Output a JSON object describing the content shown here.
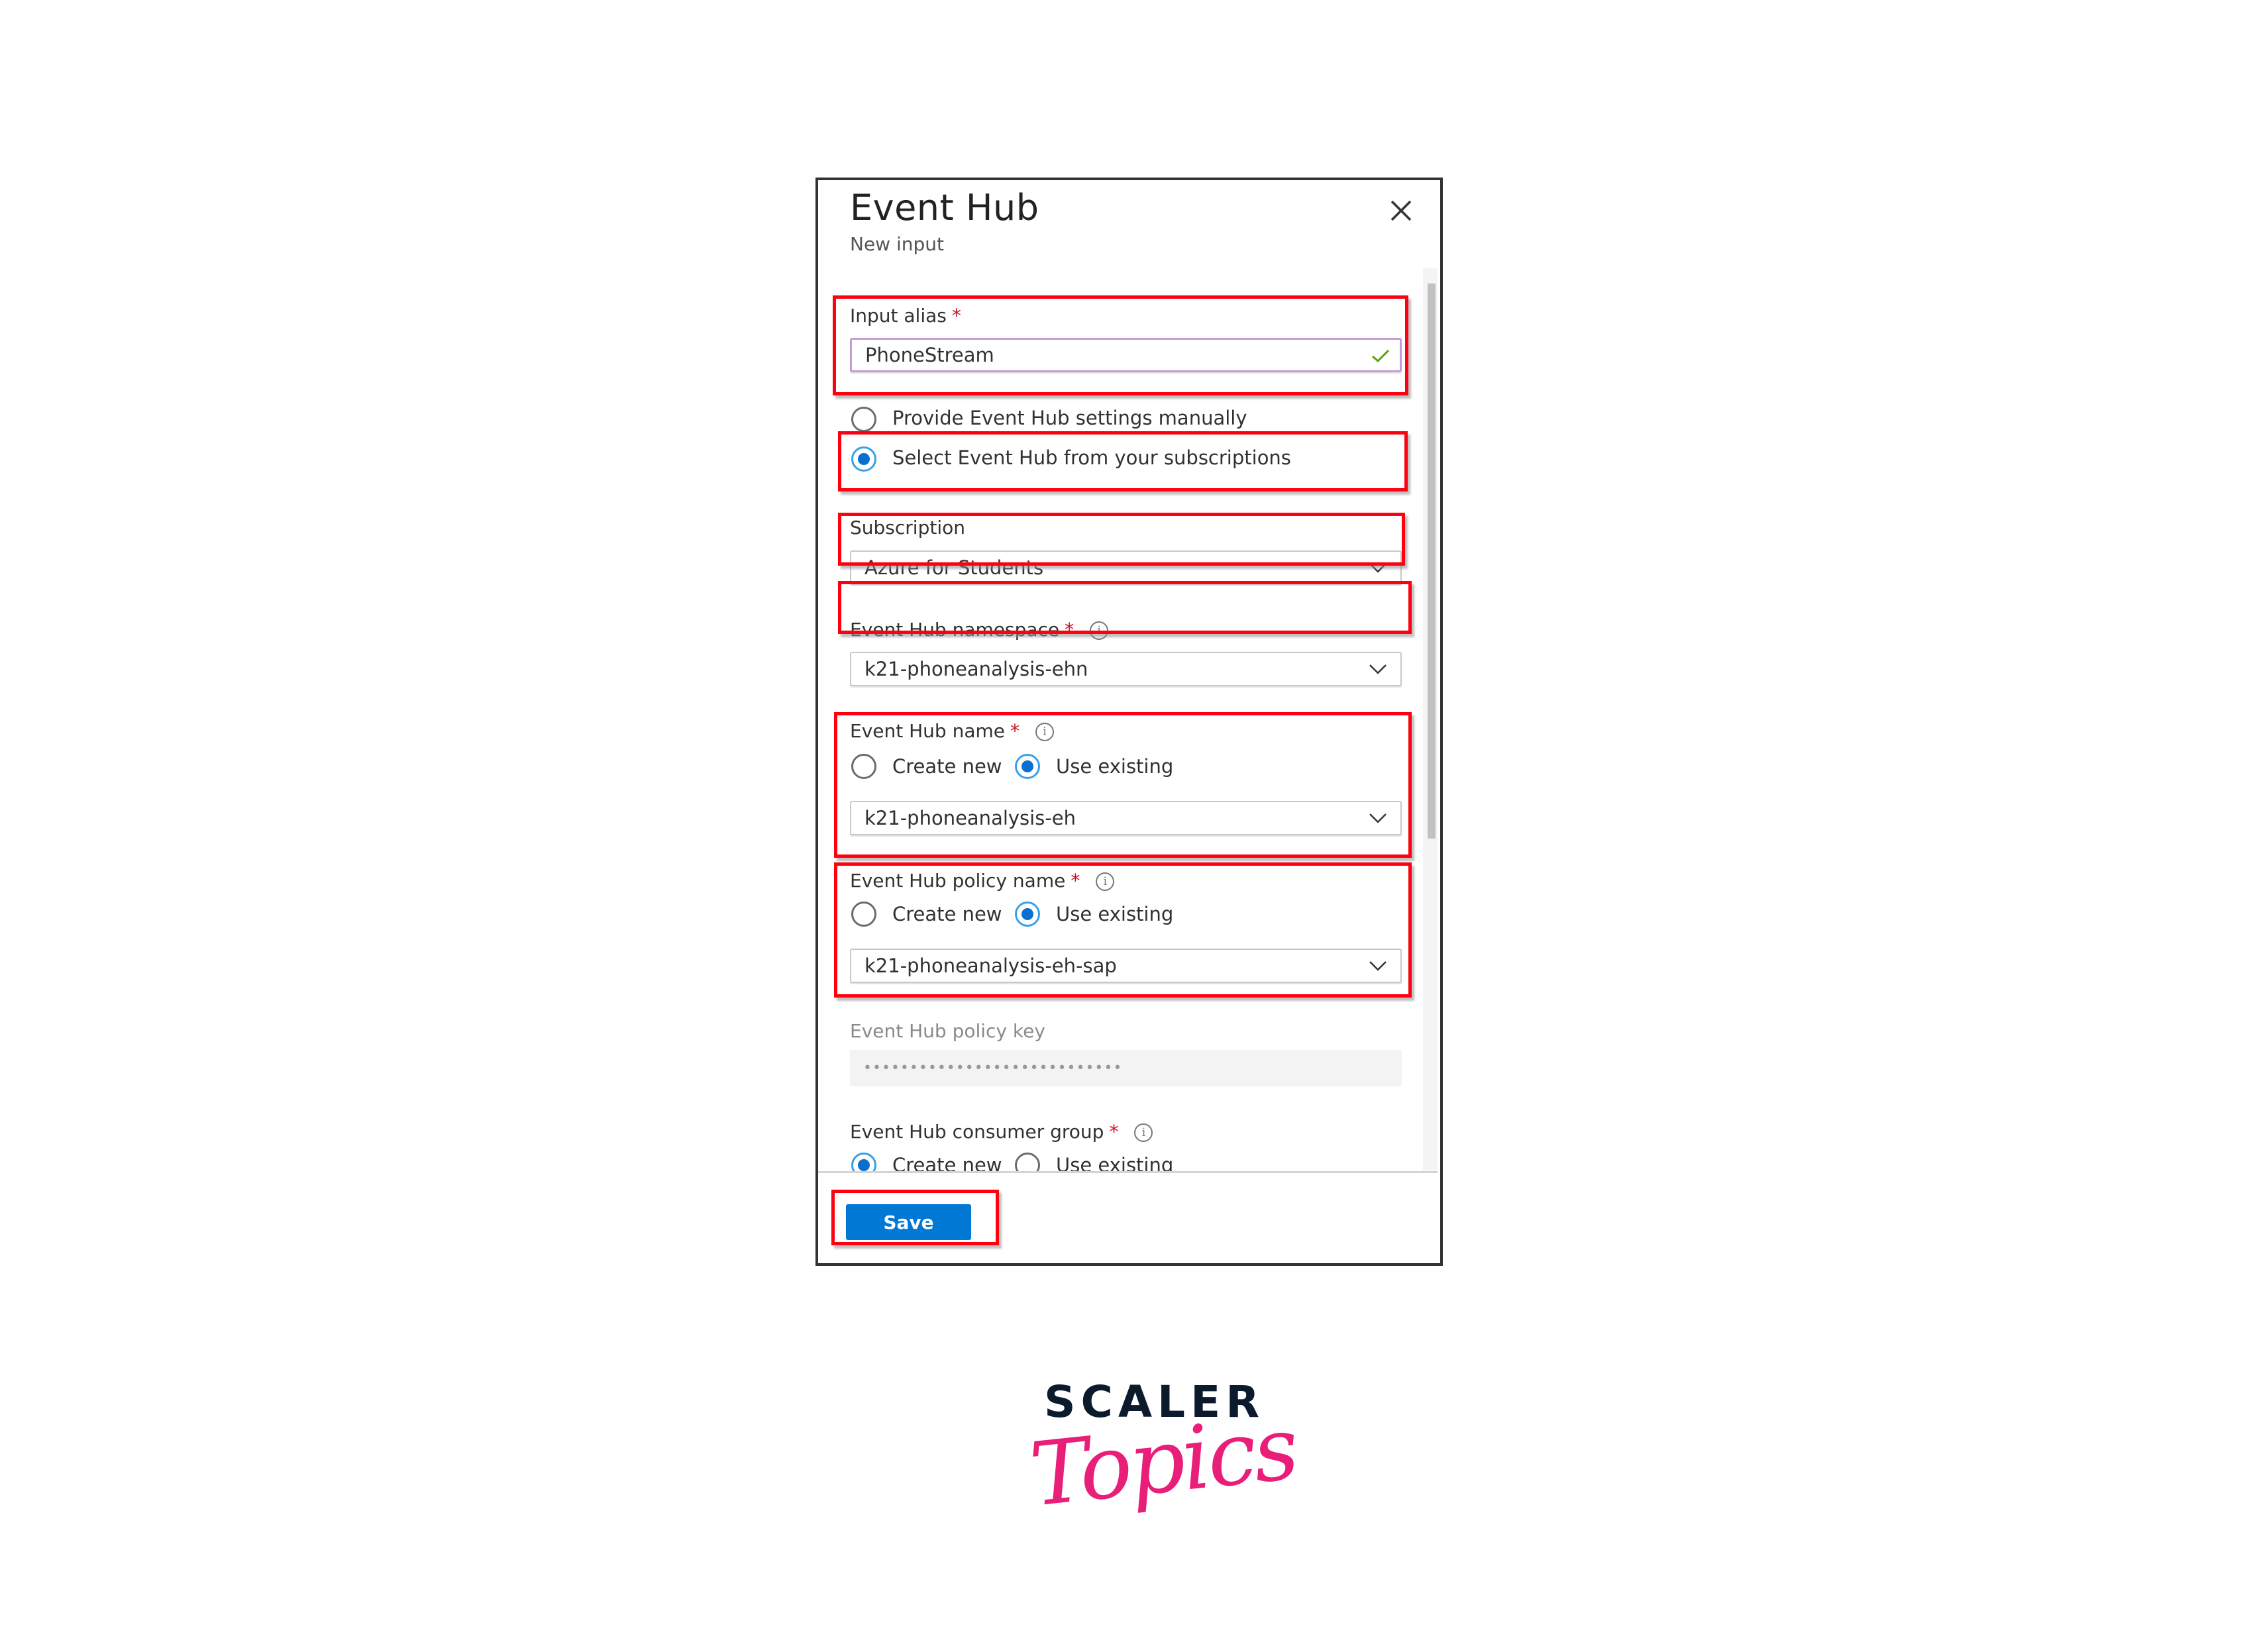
{
  "panel": {
    "title": "Event Hub",
    "subtitle": "New input",
    "close_icon": "close-icon"
  },
  "form": {
    "input_alias": {
      "label": "Input alias",
      "required_mark": "*",
      "value": "PhoneStream",
      "valid_icon": "checkmark-icon"
    },
    "source_mode": {
      "options": [
        {
          "label": "Provide Event Hub settings manually",
          "selected": false
        },
        {
          "label": "Select Event Hub from your subscriptions",
          "selected": true
        }
      ]
    },
    "subscription": {
      "label": "Subscription",
      "value": "Azure for Students"
    },
    "namespace": {
      "label": "Event Hub namespace",
      "required_mark": "*",
      "info_icon": "i",
      "value": "k21-phoneanalysis-ehn"
    },
    "hub_name": {
      "label": "Event Hub name",
      "required_mark": "*",
      "info_icon": "i",
      "options": [
        {
          "label": "Create new",
          "selected": false
        },
        {
          "label": "Use existing",
          "selected": true
        }
      ],
      "value": "k21-phoneanalysis-eh"
    },
    "policy_name": {
      "label": "Event Hub policy name",
      "required_mark": "*",
      "info_icon": "i",
      "options": [
        {
          "label": "Create new",
          "selected": false
        },
        {
          "label": "Use existing",
          "selected": true
        }
      ],
      "value": "k21-phoneanalysis-eh-sap"
    },
    "policy_key": {
      "label": "Event Hub policy key",
      "value": "••••••••••••••••••••••••••••"
    },
    "consumer_group": {
      "label": "Event Hub consumer group",
      "required_mark": "*",
      "info_icon": "i",
      "options": [
        {
          "label": "Create new",
          "selected": true
        },
        {
          "label": "Use existing",
          "selected": false
        }
      ]
    }
  },
  "footer": {
    "save_label": "Save"
  },
  "colors": {
    "primary": "#0078d4",
    "highlight": "#ff0010",
    "required": "#c50f1f",
    "brand_pink": "#e91e79",
    "brand_navy": "#0c1a2e"
  },
  "branding": {
    "line1": "SCALER",
    "line2": "Topics"
  }
}
